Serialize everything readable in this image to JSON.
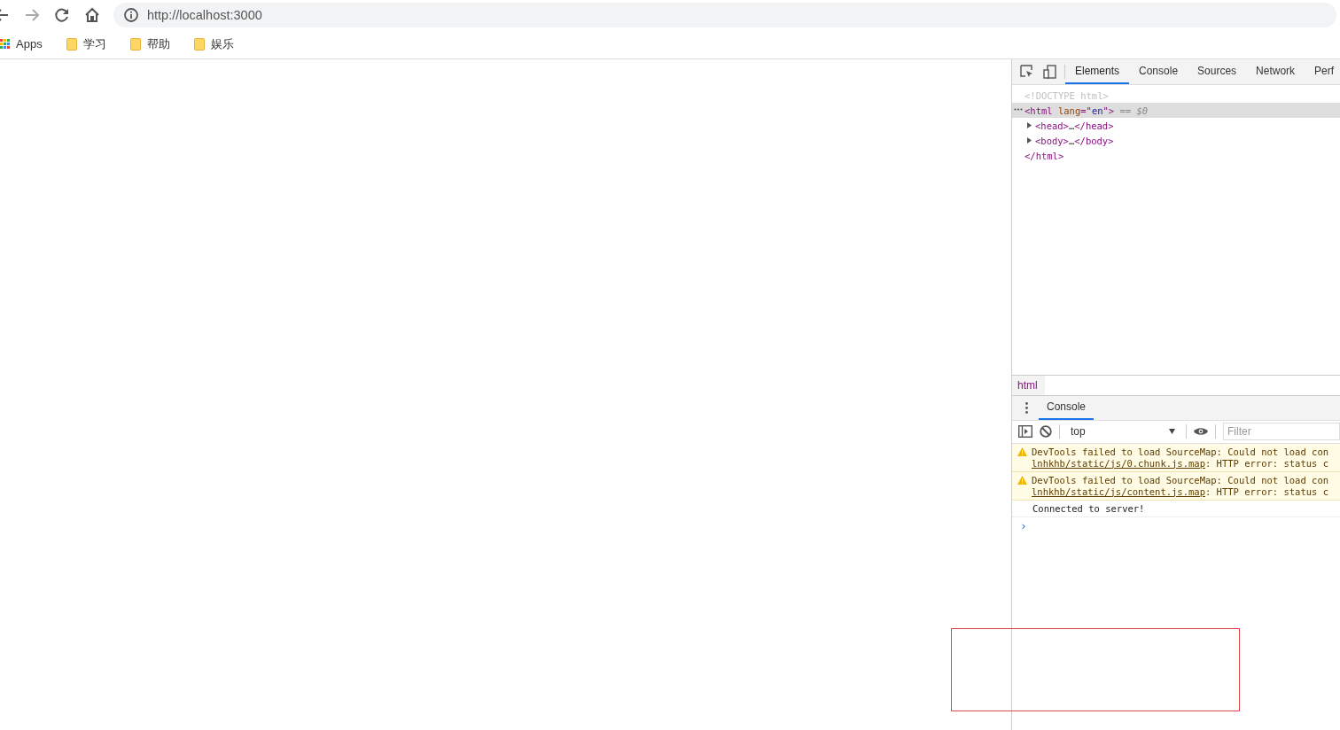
{
  "browser": {
    "url": "http://localhost:3000",
    "bookmarks": [
      {
        "kind": "apps",
        "label": "Apps"
      },
      {
        "kind": "folder",
        "label": "学习"
      },
      {
        "kind": "folder",
        "label": "帮助"
      },
      {
        "kind": "folder",
        "label": "娱乐"
      }
    ]
  },
  "devtools": {
    "tabs": [
      {
        "label": "Elements",
        "selected": true
      },
      {
        "label": "Console",
        "selected": false
      },
      {
        "label": "Sources",
        "selected": false
      },
      {
        "label": "Network",
        "selected": false
      },
      {
        "label": "Perf",
        "selected": false
      }
    ],
    "dom_tree": [
      {
        "selected": false,
        "tokens": [
          {
            "kind": "doctype",
            "text": "<!DOCTYPE html>"
          }
        ]
      },
      {
        "selected": true,
        "expanded": true,
        "tokens": [
          {
            "kind": "tag",
            "text": "<html "
          },
          {
            "kind": "attr",
            "text": "lang"
          },
          {
            "kind": "tag",
            "text": "=\""
          },
          {
            "kind": "value",
            "text": "en"
          },
          {
            "kind": "tag",
            "text": "\">"
          },
          {
            "kind": "note",
            "text": " == $0"
          }
        ],
        "children": [
          {
            "selected": false,
            "expanded": false,
            "tokens": [
              {
                "kind": "tag",
                "text": "<head>"
              },
              {
                "kind": "plain",
                "text": "…"
              },
              {
                "kind": "tag",
                "text": "</head>"
              }
            ]
          },
          {
            "selected": false,
            "expanded": false,
            "tokens": [
              {
                "kind": "tag",
                "text": "<body>"
              },
              {
                "kind": "plain",
                "text": "…"
              },
              {
                "kind": "tag",
                "text": "</body>"
              }
            ]
          }
        ],
        "closing": [
          {
            "kind": "tag",
            "text": "</html>"
          }
        ]
      }
    ],
    "breadcrumb": "html",
    "drawer": {
      "tabs": [
        {
          "label": "Console",
          "selected": true
        }
      ],
      "context": "top",
      "filter_placeholder": "Filter",
      "messages": [
        {
          "kind": "warning",
          "text": "DevTools failed to load SourceMap: Could not load con",
          "link": "lnhkhb/static/js/0.chunk.js.map",
          "rest": ": HTTP error: status c"
        },
        {
          "kind": "warning",
          "text": "DevTools failed to load SourceMap: Could not load con",
          "link": "lnhkhb/static/js/content.js.map",
          "rest": ": HTTP error: status c"
        },
        {
          "kind": "info",
          "text": "Connected to server!"
        }
      ],
      "prompt": "›"
    }
  },
  "annotation": {
    "kind": "rectangle"
  }
}
